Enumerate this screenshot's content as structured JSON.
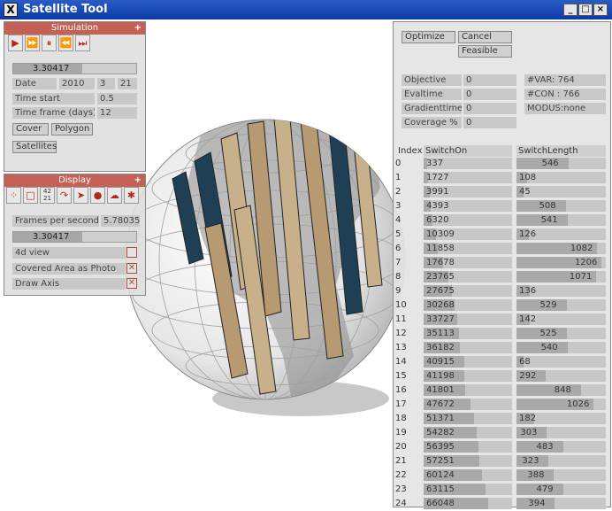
{
  "window": {
    "title": "Satellite Tool",
    "minimize": "_",
    "maximize": "□",
    "close": "×"
  },
  "simulation": {
    "header": "Simulation",
    "plus": "+",
    "time_value": "3.30417",
    "date_label": "Date",
    "date_year": "2010",
    "date_month": "3",
    "date_day": "21",
    "time_start_label": "Time start",
    "time_start_value": "0.5",
    "time_frame_label": "Time frame (days)",
    "time_frame_value": "12",
    "cover_button": "Cover",
    "polygon_button": "Polygon",
    "satellites_button": "Satellites"
  },
  "display": {
    "header": "Display",
    "plus": "+",
    "fps_label": "Frames per second",
    "fps_value": "5.78035",
    "time_value": "3.30417",
    "view4d_label": "4d view",
    "view4d_checked": false,
    "covered_area_label": "Covered Area as Photo",
    "covered_area_checked": true,
    "draw_axis_label": "Draw Axis",
    "draw_axis_checked": true,
    "tool_icons": [
      "points-icon",
      "rectangle-icon",
      "number-icon",
      "rotate-icon",
      "arrow-icon",
      "sphere-icon",
      "cloud-icon",
      "star-icon"
    ],
    "number_icon_top": "42",
    "number_icon_bottom": "21"
  },
  "optimizer": {
    "optimize_button": "Optimize",
    "cancel_button": "Cancel",
    "feasible_button": "Feasible",
    "objective_label": "Objective",
    "objective_value": "0",
    "evaltime_label": "Evaltime",
    "evaltime_value": "0",
    "gradienttime_label": "Gradienttime",
    "gradienttime_value": "0",
    "coverage_label": "Coverage %",
    "coverage_value": "0",
    "nvar": "#VAR:  764",
    "ncon": "#CON : 766",
    "modus": "MODUS:none",
    "col_index": "Index",
    "col_switchon": "SwitchOn",
    "col_switchlength": "SwitchLength"
  },
  "table": [
    {
      "index": "0",
      "on": "337",
      "on_frac": 0.04,
      "len": "546",
      "len_frac": 0.58
    },
    {
      "index": "1",
      "on": "1727",
      "on_frac": 0.05,
      "len": "108",
      "len_frac": 0.12
    },
    {
      "index": "2",
      "on": "3991",
      "on_frac": 0.07,
      "len": "45",
      "len_frac": 0.08
    },
    {
      "index": "3",
      "on": "4393",
      "on_frac": 0.08,
      "len": "508",
      "len_frac": 0.55
    },
    {
      "index": "4",
      "on": "6320",
      "on_frac": 0.1,
      "len": "541",
      "len_frac": 0.57
    },
    {
      "index": "5",
      "on": "10309",
      "on_frac": 0.14,
      "len": "126",
      "len_frac": 0.14
    },
    {
      "index": "6",
      "on": "11858",
      "on_frac": 0.16,
      "len": "1082",
      "len_frac": 0.9
    },
    {
      "index": "7",
      "on": "17678",
      "on_frac": 0.22,
      "len": "1206",
      "len_frac": 0.95
    },
    {
      "index": "8",
      "on": "23765",
      "on_frac": 0.28,
      "len": "1071",
      "len_frac": 0.89
    },
    {
      "index": "9",
      "on": "27675",
      "on_frac": 0.32,
      "len": "136",
      "len_frac": 0.15
    },
    {
      "index": "10",
      "on": "30268",
      "on_frac": 0.35,
      "len": "529",
      "len_frac": 0.56
    },
    {
      "index": "11",
      "on": "33727",
      "on_frac": 0.38,
      "len": "142",
      "len_frac": 0.15
    },
    {
      "index": "12",
      "on": "35113",
      "on_frac": 0.4,
      "len": "525",
      "len_frac": 0.56
    },
    {
      "index": "13",
      "on": "36182",
      "on_frac": 0.41,
      "len": "540",
      "len_frac": 0.57
    },
    {
      "index": "14",
      "on": "40915",
      "on_frac": 0.46,
      "len": "68",
      "len_frac": 0.08
    },
    {
      "index": "15",
      "on": "41198",
      "on_frac": 0.46,
      "len": "292",
      "len_frac": 0.33
    },
    {
      "index": "16",
      "on": "41801",
      "on_frac": 0.47,
      "len": "848",
      "len_frac": 0.72
    },
    {
      "index": "17",
      "on": "47672",
      "on_frac": 0.53,
      "len": "1026",
      "len_frac": 0.86
    },
    {
      "index": "18",
      "on": "51371",
      "on_frac": 0.57,
      "len": "182",
      "len_frac": 0.2
    },
    {
      "index": "19",
      "on": "54282",
      "on_frac": 0.6,
      "len": "303",
      "len_frac": 0.34
    },
    {
      "index": "20",
      "on": "56395",
      "on_frac": 0.62,
      "len": "483",
      "len_frac": 0.52
    },
    {
      "index": "21",
      "on": "57251",
      "on_frac": 0.63,
      "len": "323",
      "len_frac": 0.36
    },
    {
      "index": "22",
      "on": "60124",
      "on_frac": 0.66,
      "len": "388",
      "len_frac": 0.42
    },
    {
      "index": "23",
      "on": "63115",
      "on_frac": 0.7,
      "len": "479",
      "len_frac": 0.52
    },
    {
      "index": "24",
      "on": "66048",
      "on_frac": 0.73,
      "len": "394",
      "len_frac": 0.43
    }
  ]
}
